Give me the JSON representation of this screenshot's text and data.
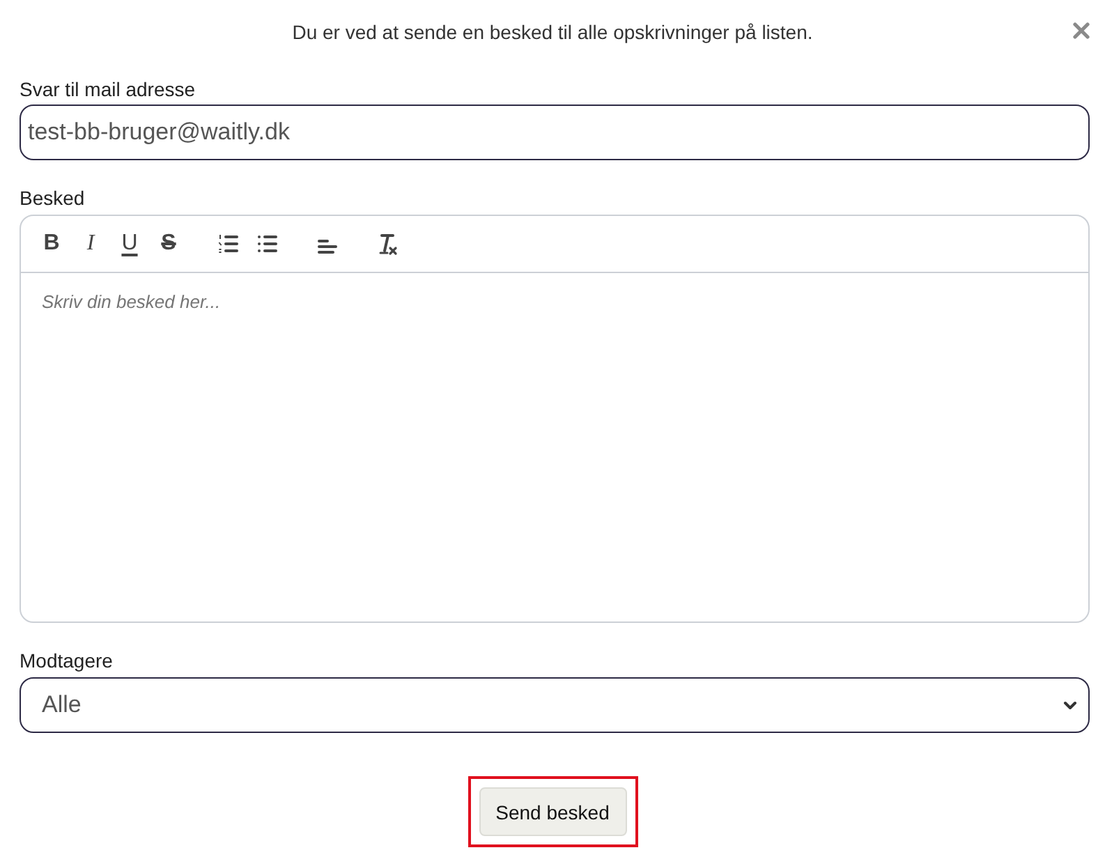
{
  "header": {
    "message": "Du er ved at sende en besked til alle opskrivninger på listen."
  },
  "reply_email": {
    "label": "Svar til mail adresse",
    "value": "test-bb-bruger@waitly.dk"
  },
  "message": {
    "label": "Besked",
    "toolbar": [
      {
        "buttons": [
          {
            "kind": "bold",
            "label": "B"
          },
          {
            "kind": "italic",
            "label": "I"
          },
          {
            "kind": "underline",
            "label": "U"
          },
          {
            "kind": "strike",
            "label": "S"
          }
        ]
      },
      {
        "buttons": [
          {
            "kind": "ordered-list"
          },
          {
            "kind": "bullet-list"
          }
        ]
      },
      {
        "buttons": [
          {
            "kind": "align"
          }
        ]
      },
      {
        "buttons": [
          {
            "kind": "clean"
          }
        ]
      }
    ],
    "placeholder": "Skriv din besked her..."
  },
  "recipients": {
    "label": "Modtagere",
    "value": "Alle"
  },
  "send_button": {
    "label": "Send besked",
    "highlighted": true
  }
}
